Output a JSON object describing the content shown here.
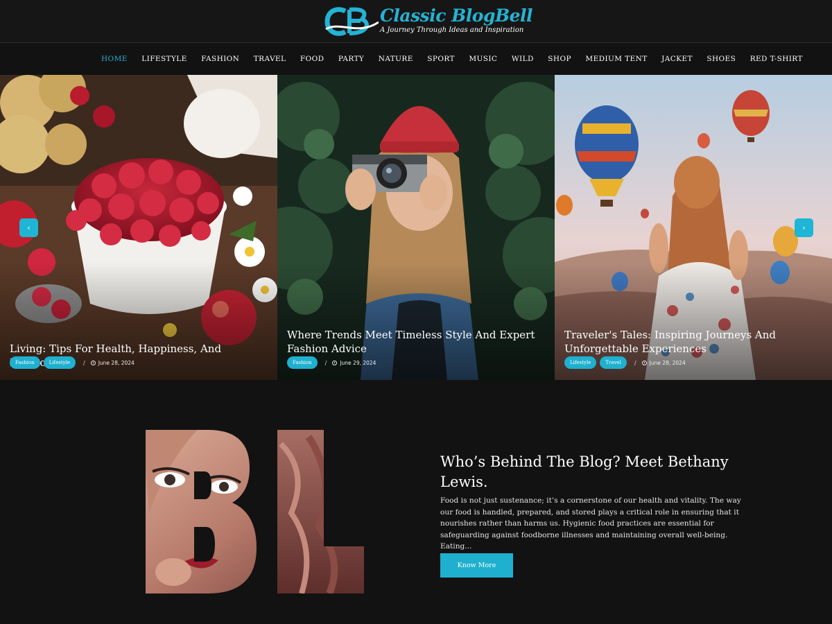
{
  "site": {
    "title": "Classic BlogBell",
    "tagline": "A Journey Through Ideas and Inspiration",
    "logo_icon": "cb-monogram-logo",
    "accent": "#1fb0cf"
  },
  "nav": {
    "items": [
      "HOME",
      "LIFESTYLE",
      "FASHION",
      "TRAVEL",
      "FOOD",
      "PARTY",
      "NATURE",
      "SPORT",
      "MUSIC",
      "WILD",
      "SHOP",
      "MEDIUM TENT",
      "JACKET",
      "SHOES",
      "RED T-SHIRT"
    ],
    "active": "HOME"
  },
  "slider": {
    "prev_icon": "chevron-left-icon",
    "prev_glyph": "‹",
    "next_icon": "chevron-right-icon",
    "next_glyph": "›",
    "slides": [
      {
        "title": "Living: Tips For Health, Happiness, And Harmony”",
        "tags": [
          "Fashion",
          "Lifestyle"
        ],
        "date": "June 28, 2024",
        "image": "raspberries-bowl-photo"
      },
      {
        "title": "Where Trends Meet Timeless Style And Expert Fashion Advice",
        "tags": [
          "Fashion"
        ],
        "date": "June 29, 2024",
        "image": "woman-with-camera-photo"
      },
      {
        "title": "Traveler's Tales: Inspiring Journeys And Unforgettable Experiences",
        "tags": [
          "Lifestyle",
          "Travel"
        ],
        "date": "June 28, 2024",
        "image": "hot-air-balloons-photo"
      }
    ],
    "separator": "/"
  },
  "about": {
    "art_letters": "BL",
    "title": "Who’s Behind The Blog? Meet Bethany Lewis.",
    "text": "Food is not just sustenance; it’s a cornerstone of our health and vitality. The way our food is handled, prepared, and stored plays a critical role in ensuring that it nourishes rather than harms us. Hygienic food practices are essential for safeguarding against foodborne illnesses and maintaining overall well-being. Eating...",
    "button": "Know More"
  }
}
